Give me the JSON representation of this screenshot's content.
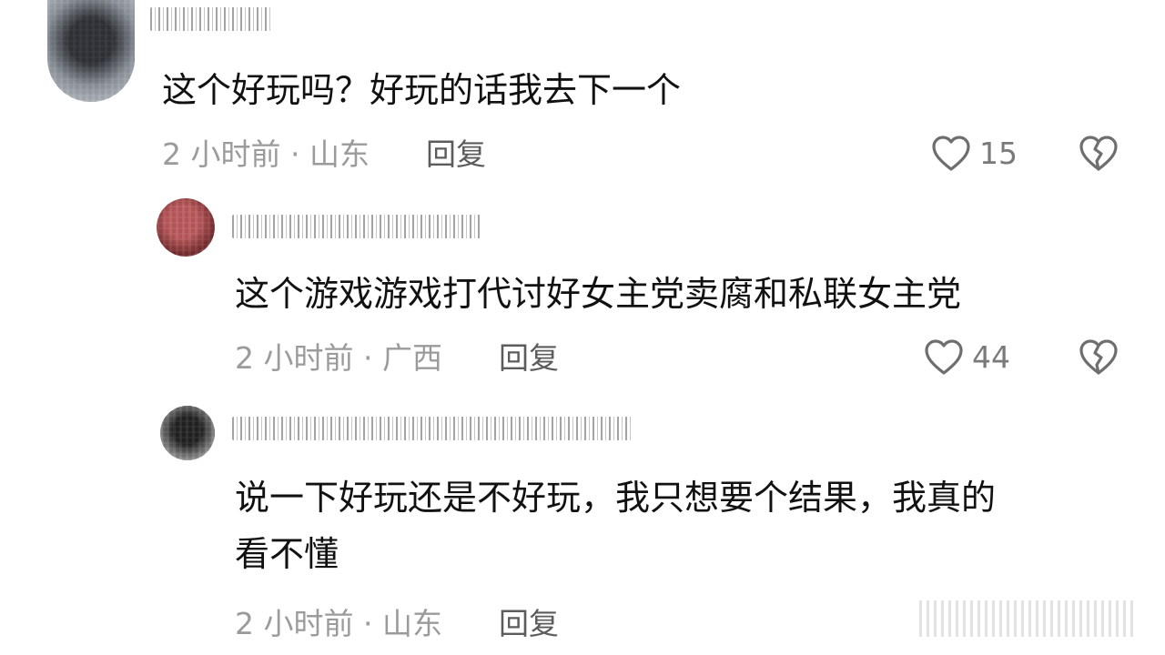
{
  "comments": [
    {
      "text": "这个好玩吗？好玩的话我去下一个",
      "time_location": "2 小时前 · 山东",
      "reply_label": "回复",
      "likes": "15"
    },
    {
      "text": "这个游戏游戏打代讨好女主党卖腐和私联女主党",
      "time_location": "2 小时前 · 广西",
      "reply_label": "回复",
      "likes": "44"
    },
    {
      "text": "说一下好玩还是不好玩，我只想要个结果，我真的\n看不懂",
      "time_location": "2 小时前 · 山东",
      "reply_label": "回复"
    }
  ],
  "icons": {
    "like": "heart-outline-icon",
    "dislike": "broken-heart-icon"
  },
  "colors": {
    "text": "#111111",
    "meta": "#9b9b9b",
    "reply": "#5c5c5c",
    "icon": "#6e6e6e"
  }
}
